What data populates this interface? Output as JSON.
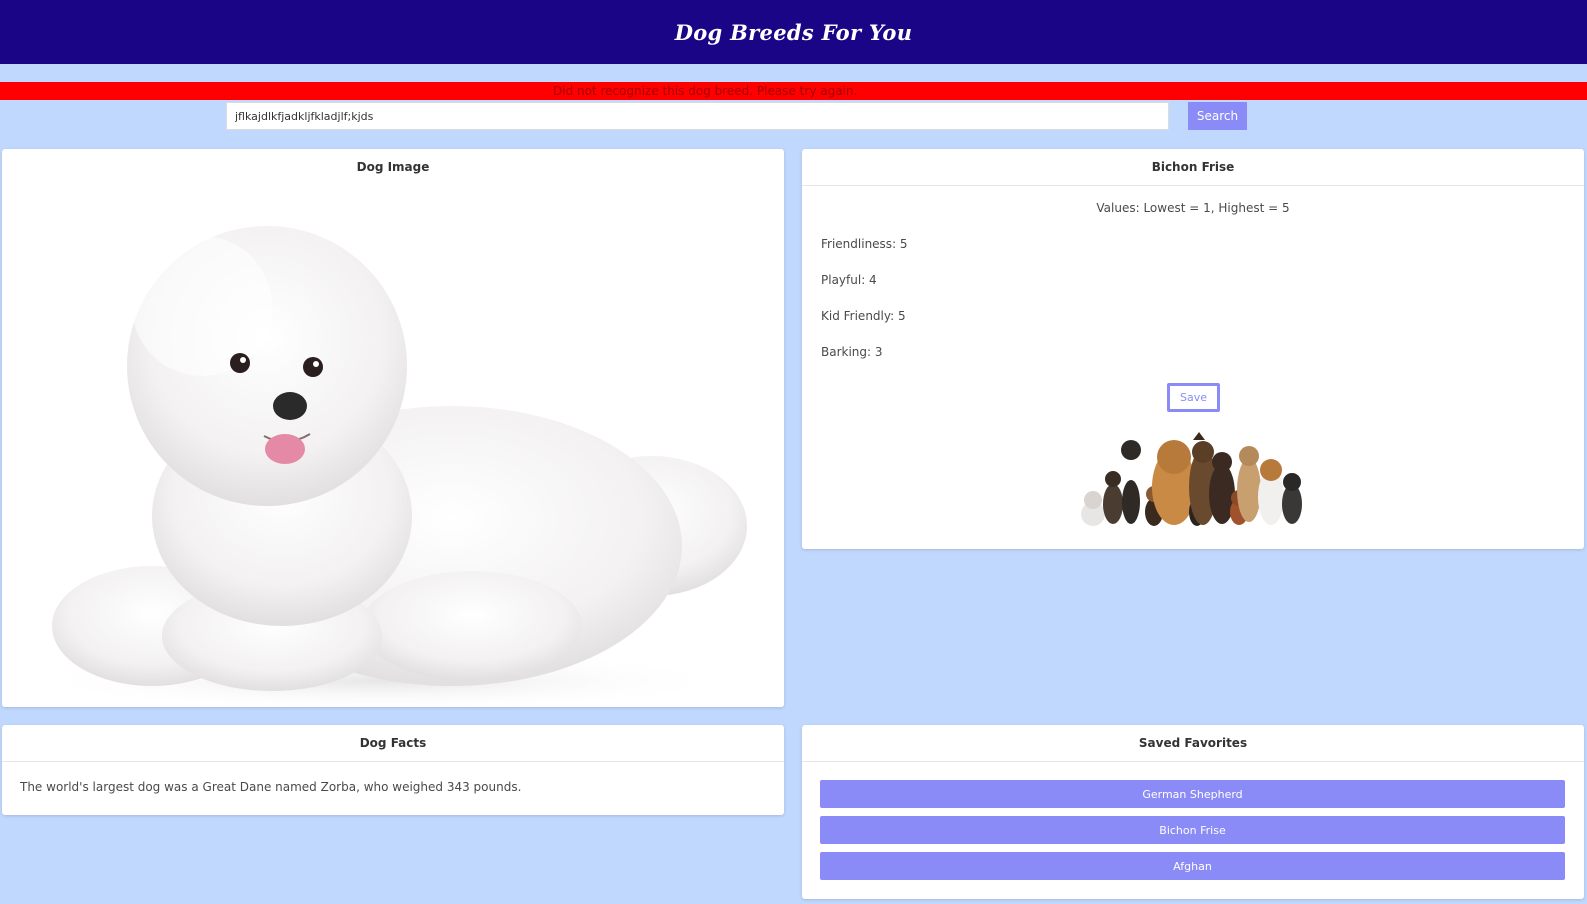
{
  "header": {
    "title": "Dog Breeds For You"
  },
  "error": {
    "message": "Did not recognize this dog breed. Please try again."
  },
  "search": {
    "value": "jflkajdlkfjadkljfkladjlf;kjds",
    "button_label": "Search"
  },
  "image_card": {
    "title": "Dog Image"
  },
  "breed": {
    "name": "Bichon Frise",
    "values_note": "Values: Lowest = 1, Highest = 5",
    "traits": [
      {
        "label": "Friendliness: 5"
      },
      {
        "label": "Playful: 4"
      },
      {
        "label": "Kid Friendly: 5"
      },
      {
        "label": "Barking: 3"
      }
    ],
    "save_label": "Save"
  },
  "facts": {
    "title": "Dog Facts",
    "text": "The world's largest dog was a Great Dane named Zorba, who weighed 343 pounds."
  },
  "favorites": {
    "title": "Saved Favorites",
    "items": [
      "German Shepherd",
      "Bichon Frise",
      "Afghan"
    ]
  },
  "colors": {
    "header_bg": "#190585",
    "page_bg": "#c1d8fe",
    "accent": "#8b8bf7",
    "error_bg": "#ff0000"
  }
}
